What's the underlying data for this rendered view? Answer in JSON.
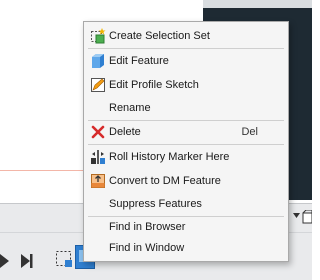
{
  "context_menu": {
    "items": [
      {
        "label": "Create Selection Set",
        "icon": "selection-set-icon"
      },
      {
        "label": "Edit Feature",
        "icon": "edit-feature-icon"
      },
      {
        "label": "Edit Profile Sketch",
        "icon": "edit-sketch-icon"
      },
      {
        "label": "Rename",
        "icon": ""
      },
      {
        "label": "Delete",
        "icon": "delete-x-icon",
        "shortcut": "Del"
      },
      {
        "label": "Roll History Marker Here",
        "icon": "roll-marker-icon"
      },
      {
        "label": "Convert to DM Feature",
        "icon": "convert-dm-icon"
      },
      {
        "label": "Suppress Features",
        "icon": ""
      },
      {
        "label": "Find in Browser",
        "icon": ""
      },
      {
        "label": "Find in Window",
        "icon": ""
      }
    ]
  },
  "timeline": {
    "controls": [
      "play-icon",
      "step-end-icon",
      "selection-feature-icon",
      "current-feature-icon",
      "dropdown-arrow-icon",
      "view-cube-icon"
    ]
  },
  "colors": {
    "delete_red": "#d62b2b",
    "accent_blue": "#2f7fd1",
    "menu_bg": "#f5f5f5",
    "dark_panel": "#1e2a33"
  }
}
